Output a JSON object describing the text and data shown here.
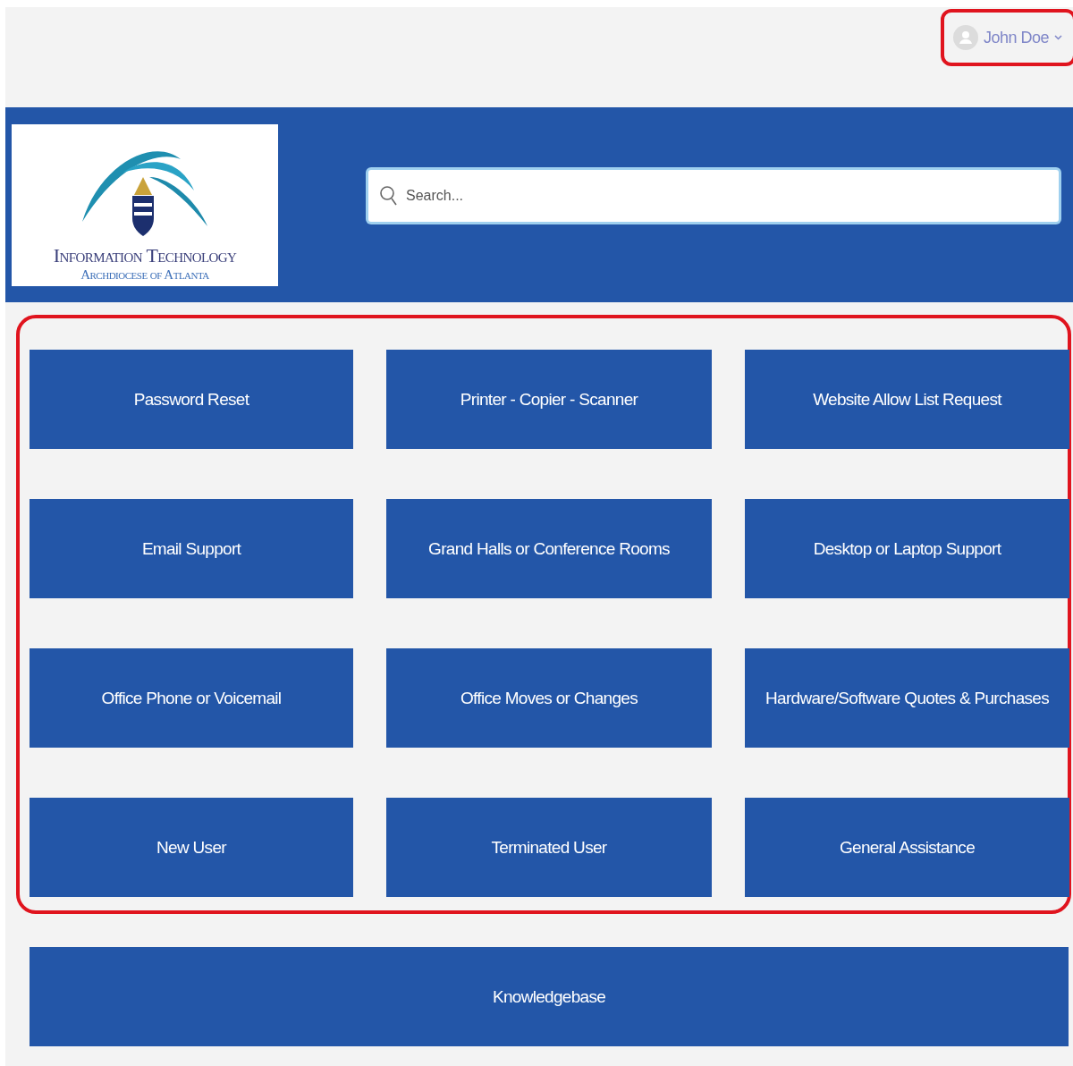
{
  "user_menu": {
    "name": "John Doe"
  },
  "logo": {
    "title": "Information Technology",
    "subtitle": "Archdiocese of Atlanta"
  },
  "search": {
    "placeholder": "Search..."
  },
  "tiles": [
    {
      "label": "Password Reset"
    },
    {
      "label": "Printer - Copier - Scanner"
    },
    {
      "label": "Website Allow List Request"
    },
    {
      "label": "Email Support"
    },
    {
      "label": "Grand Halls or Conference Rooms"
    },
    {
      "label": "Desktop or Laptop Support"
    },
    {
      "label": "Office Phone or Voicemail"
    },
    {
      "label": "Office Moves or Changes"
    },
    {
      "label": "Hardware/Software Quotes & Purchases"
    },
    {
      "label": "New User"
    },
    {
      "label": "Terminated User"
    },
    {
      "label": "General Assistance"
    }
  ],
  "knowledgebase": {
    "label": "Knowledgebase"
  }
}
